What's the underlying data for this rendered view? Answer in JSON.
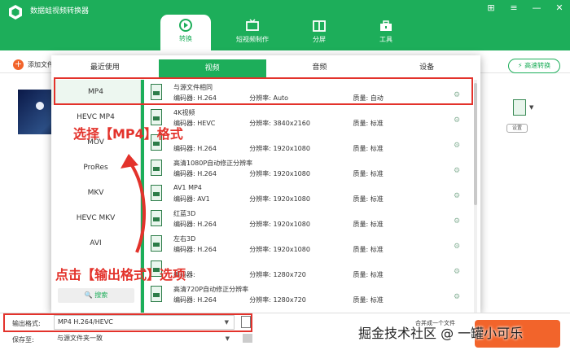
{
  "app": {
    "title": "数据蛙视频转换器"
  },
  "window_controls": [
    "⊞",
    "≡",
    "—",
    "✕"
  ],
  "main_tabs": [
    {
      "label": "转换",
      "icon": "convert-icon"
    },
    {
      "label": "短视频制作",
      "icon": "tv-icon"
    },
    {
      "label": "分屏",
      "icon": "split-screen-icon"
    },
    {
      "label": "工具",
      "icon": "toolbox-icon"
    }
  ],
  "toolbar": {
    "add_label": "添加文件",
    "speed_label": "高速转换"
  },
  "file": {
    "settings_label": "设置"
  },
  "format_panel": {
    "tabs": [
      "最近使用",
      "视频",
      "音频",
      "设备"
    ],
    "active_tab": "视频",
    "formats": [
      "MP4",
      "HEVC MP4",
      "MOV",
      "ProRes",
      "MKV",
      "HEVC MKV",
      "AVI"
    ],
    "selected_format": "MP4",
    "search_label": "搜索",
    "rows": [
      {
        "name": "与源文件相同",
        "codec_label": "编码器:",
        "codec": "H.264",
        "res_label": "分辨率:",
        "res": "Auto",
        "q_label": "质量:",
        "quality": "自动"
      },
      {
        "name": "4K视频",
        "codec_label": "编码器:",
        "codec": "HEVC",
        "res_label": "分辨率:",
        "res": "3840x2160",
        "q_label": "质量:",
        "quality": "标准"
      },
      {
        "name": "",
        "codec_label": "编码器:",
        "codec": "H.264",
        "res_label": "分辨率:",
        "res": "1920x1080",
        "q_label": "质量:",
        "quality": "标准"
      },
      {
        "name": "高清1080P自动修正分辨率",
        "codec_label": "编码器:",
        "codec": "H.264",
        "res_label": "分辨率:",
        "res": "1920x1080",
        "q_label": "质量:",
        "quality": "标准"
      },
      {
        "name": "AV1 MP4",
        "codec_label": "编码器:",
        "codec": "AV1",
        "res_label": "分辨率:",
        "res": "1920x1080",
        "q_label": "质量:",
        "quality": "标准"
      },
      {
        "name": "红蓝3D",
        "codec_label": "编码器:",
        "codec": "H.264",
        "res_label": "分辨率:",
        "res": "1920x1080",
        "q_label": "质量:",
        "quality": "标准"
      },
      {
        "name": "左右3D",
        "codec_label": "编码器:",
        "codec": "H.264",
        "res_label": "分辨率:",
        "res": "1920x1080",
        "q_label": "质量:",
        "quality": "标准"
      },
      {
        "name": "",
        "codec_label": "编码器:",
        "codec": "",
        "res_label": "分辨率:",
        "res": "1280x720",
        "q_label": "质量:",
        "quality": "标准"
      },
      {
        "name": "高清720P自动修正分辨率",
        "codec_label": "编码器:",
        "codec": "H.264",
        "res_label": "分辨率:",
        "res": "1280x720",
        "q_label": "质量:",
        "quality": "标准"
      }
    ]
  },
  "output": {
    "format_label": "输出格式:",
    "format_value": "MP4 H.264/HEVC",
    "save_label": "保存至:",
    "save_value": "与源文件夹一致",
    "merge_label": "合并成一个文件"
  },
  "annotations": {
    "select_mp4": "选择【MP4】格式",
    "click_output": "点击【输出格式】选项"
  },
  "watermark": "掘金技术社区 @ 一罐小可乐",
  "colors": {
    "brand": "#1dae5a",
    "accent": "#f2642b",
    "annotation": "#e3322b"
  }
}
